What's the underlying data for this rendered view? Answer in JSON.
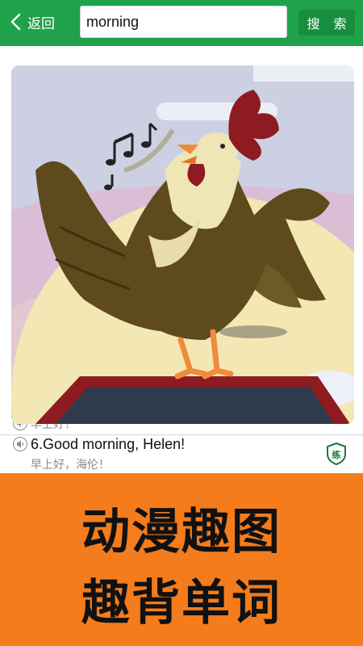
{
  "header": {
    "back_label": "返回",
    "search_value": "morning",
    "search_button": "搜 索"
  },
  "entries": [
    {
      "english": "",
      "chinese": "早上好！"
    },
    {
      "english": "6.Good morning, Helen!",
      "chinese": "早上好，海伦！",
      "practice_label": "练"
    }
  ],
  "banner": {
    "line1": "动漫趣图",
    "line2": "趣背单词"
  },
  "colors": {
    "header_green": "#1fa24a",
    "button_green": "#178e3e",
    "banner_orange": "#f47c1c",
    "slogan_text": "#111111"
  },
  "icons": [
    "chevron-left-icon",
    "speaker-icon",
    "practice-shield-icon",
    "music-notes-icon",
    "rooster-illustration"
  ]
}
